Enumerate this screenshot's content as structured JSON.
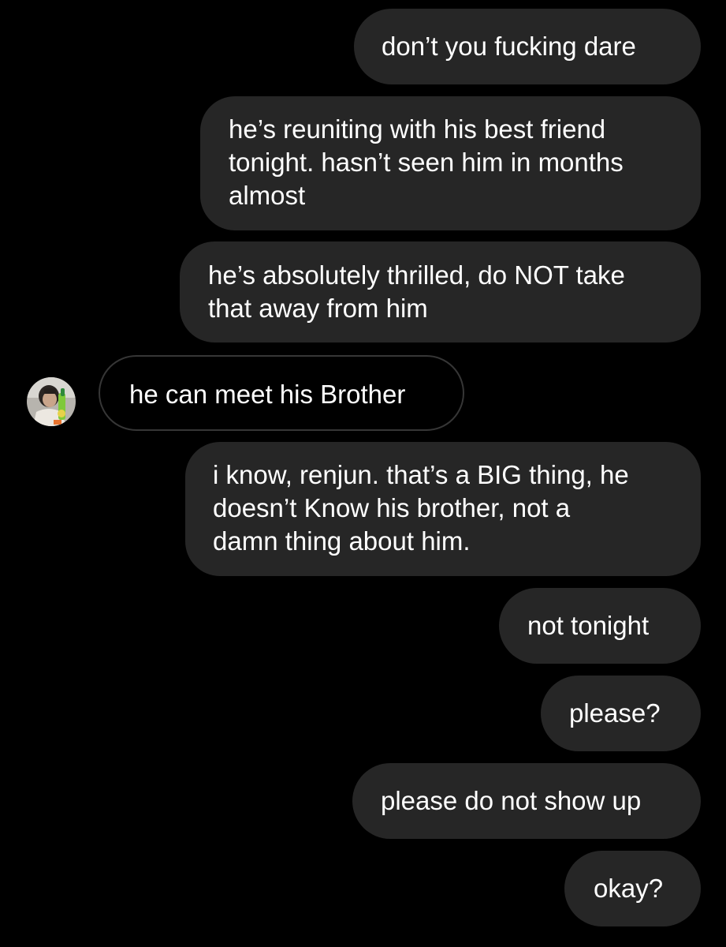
{
  "colors": {
    "background": "#000000",
    "sent_bubble": "#262626",
    "received_bubble_border": "#363636",
    "text": "#ffffff"
  },
  "contact": {
    "avatar_icon": "profile-photo-icon"
  },
  "messages": [
    {
      "sender": "me",
      "text": "don’t you fucking dare"
    },
    {
      "sender": "me",
      "text": "he’s reuniting with his best friend\ntonight. hasn’t seen him in months\nalmost"
    },
    {
      "sender": "me",
      "text": "he’s absolutely thrilled, do NOT take\nthat away from him"
    },
    {
      "sender": "contact",
      "text": "he can meet his Brother"
    },
    {
      "sender": "me",
      "text": "i know, renjun. that’s a BIG thing, he\ndoesn’t Know his brother, not a\ndamn thing about him."
    },
    {
      "sender": "me",
      "text": "not tonight"
    },
    {
      "sender": "me",
      "text": "please?"
    },
    {
      "sender": "me",
      "text": "please do not show up"
    },
    {
      "sender": "me",
      "text": "okay?"
    }
  ]
}
